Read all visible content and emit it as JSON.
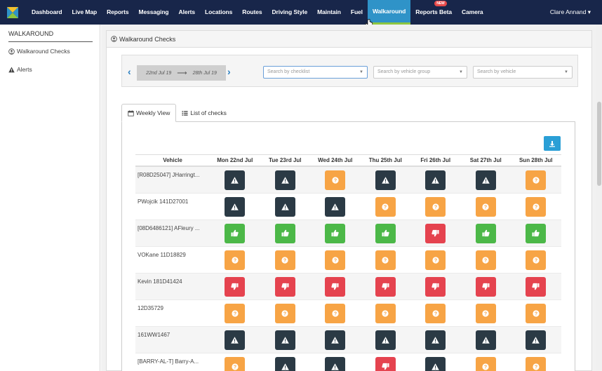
{
  "nav": {
    "items": [
      {
        "label": "Dashboard"
      },
      {
        "label": "Live Map"
      },
      {
        "label": "Reports"
      },
      {
        "label": "Messaging"
      },
      {
        "label": "Alerts"
      },
      {
        "label": "Locations"
      },
      {
        "label": "Routes"
      },
      {
        "label": "Driving Style"
      },
      {
        "label": "Maintain"
      },
      {
        "label": "Fuel"
      },
      {
        "label": "Walkaround",
        "active": true
      },
      {
        "label": "Reports Beta",
        "badge": "NEW"
      },
      {
        "label": "Camera"
      }
    ],
    "user": "Clare Annand ▾"
  },
  "sidebar": {
    "title": "WALKAROUND",
    "items": [
      {
        "label": "Walkaround Checks",
        "icon": "user-circle-icon"
      },
      {
        "label": "Alerts",
        "icon": "warning-icon"
      }
    ]
  },
  "panel": {
    "title": "Walkaround Checks"
  },
  "filters": {
    "date_from": "22nd Jul 19",
    "date_to": "28th Jul 19",
    "checklist_placeholder": "Search by checklist",
    "vehicle_group_placeholder": "Search by vehicle group",
    "vehicle_placeholder": "Search by vehicle"
  },
  "tabs": [
    {
      "label": "Weekly View",
      "active": true
    },
    {
      "label": "List of checks"
    }
  ],
  "grid": {
    "vehicle_header": "Vehicle",
    "days": [
      "Mon 22nd Jul",
      "Tue 23rd Jul",
      "Wed 24th Jul",
      "Thu 25th Jul",
      "Fri 26th Jul",
      "Sat 27th Jul",
      "Sun 28th Jul"
    ],
    "rows": [
      {
        "vehicle": "[R08D25047] JHarringt...",
        "statuses": [
          "warning",
          "warning",
          "unknown",
          "warning",
          "warning",
          "warning",
          "unknown"
        ]
      },
      {
        "vehicle": "PWojcik 141D27001",
        "statuses": [
          "warning",
          "warning",
          "warning",
          "unknown",
          "unknown",
          "unknown",
          "unknown"
        ]
      },
      {
        "vehicle": "[08D6486121] AFleury ...",
        "statuses": [
          "pass",
          "pass",
          "pass",
          "pass",
          "fail",
          "pass",
          "pass"
        ]
      },
      {
        "vehicle": "VOKane 11D18829",
        "statuses": [
          "unknown",
          "unknown",
          "unknown",
          "unknown",
          "unknown",
          "unknown",
          "unknown"
        ]
      },
      {
        "vehicle": "Kevin 181D41424",
        "statuses": [
          "fail",
          "fail",
          "fail",
          "fail",
          "fail",
          "fail",
          "fail"
        ]
      },
      {
        "vehicle": "12D35729",
        "statuses": [
          "unknown",
          "unknown",
          "unknown",
          "unknown",
          "unknown",
          "unknown",
          "unknown"
        ]
      },
      {
        "vehicle": "161WW1467",
        "statuses": [
          "warning",
          "warning",
          "warning",
          "warning",
          "warning",
          "warning",
          "warning"
        ]
      },
      {
        "vehicle": "[BARRY-AL-T] Barry-A...",
        "statuses": [
          "unknown",
          "warning",
          "warning",
          "fail",
          "warning",
          "unknown",
          "unknown"
        ]
      }
    ]
  },
  "colors": {
    "navbar": "#18264a",
    "active_tab": "#2f93c8",
    "warning": "#2b3a45",
    "unknown": "#f7a445",
    "pass": "#4cb848",
    "fail": "#e5434f"
  }
}
